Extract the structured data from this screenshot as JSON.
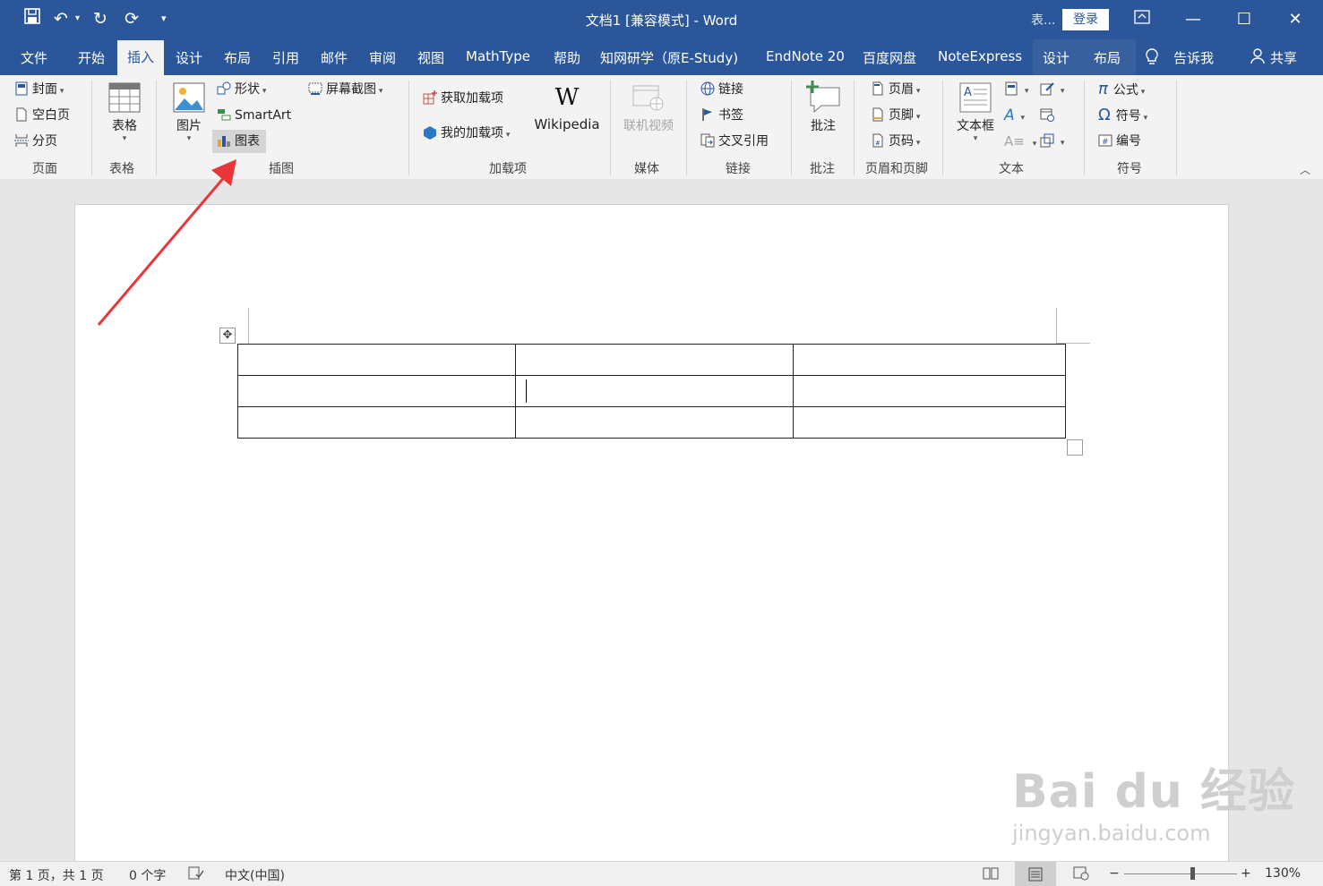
{
  "titlebar": {
    "title": "文档1 [兼容模式]  -  Word",
    "context_label": "表...",
    "login_label": "登录",
    "qat": [
      "save-icon",
      "undo-icon",
      "redo-icon",
      "refresh-icon",
      "customize-icon"
    ],
    "window_buttons": [
      "ribbon-display-icon",
      "minimize-icon",
      "maximize-icon",
      "close-icon"
    ]
  },
  "tabs": [
    {
      "label": "文件"
    },
    {
      "label": "开始"
    },
    {
      "label": "插入",
      "active": true
    },
    {
      "label": "设计"
    },
    {
      "label": "布局"
    },
    {
      "label": "引用"
    },
    {
      "label": "邮件"
    },
    {
      "label": "审阅"
    },
    {
      "label": "视图"
    },
    {
      "label": "MathType"
    },
    {
      "label": "帮助"
    },
    {
      "label": "知网研学（原E-Study)"
    },
    {
      "label": "EndNote 20"
    },
    {
      "label": "百度网盘"
    },
    {
      "label": "NoteExpress"
    },
    {
      "label": "设计"
    },
    {
      "label": "布局"
    }
  ],
  "tell_me": "告诉我",
  "share": "共享",
  "ribbon": {
    "pages": {
      "label": "页面",
      "cover": "封面",
      "blank": "空白页",
      "break": "分页"
    },
    "tables": {
      "label": "表格",
      "table": "表格"
    },
    "illustrations": {
      "label": "插图",
      "picture": "图片",
      "shapes": "形状",
      "smartart": "SmartArt",
      "chart": "图表",
      "screenshot": "屏幕截图"
    },
    "addins": {
      "label": "加载项",
      "get": "获取加载项",
      "my": "我的加载项",
      "wikipedia": "Wikipedia",
      "wiki_glyph": "W"
    },
    "media": {
      "label": "媒体",
      "online_video": "联机视频"
    },
    "links": {
      "label": "链接",
      "link": "链接",
      "bookmark": "书签",
      "crossref": "交叉引用"
    },
    "comments": {
      "label": "批注",
      "comment": "批注"
    },
    "headerfooter": {
      "label": "页眉和页脚",
      "header": "页眉",
      "footer": "页脚",
      "pagenum": "页码"
    },
    "text": {
      "label": "文本",
      "textbox": "文本框"
    },
    "symbols": {
      "label": "符号",
      "equation": "公式",
      "symbol": "符号",
      "numbering": "编号"
    }
  },
  "document": {
    "table_rows": 3,
    "table_cols": 3
  },
  "statusbar": {
    "page": "第 1 页，共 1 页",
    "words": "0 个字",
    "language": "中文(中国)",
    "zoom": "130%",
    "zoom_level": 0.6
  },
  "watermark": {
    "brand": "Bai du 经验",
    "url": "jingyan.baidu.com"
  },
  "colors": {
    "accent": "#2b579a",
    "annotation_arrow": "#e8363a"
  }
}
